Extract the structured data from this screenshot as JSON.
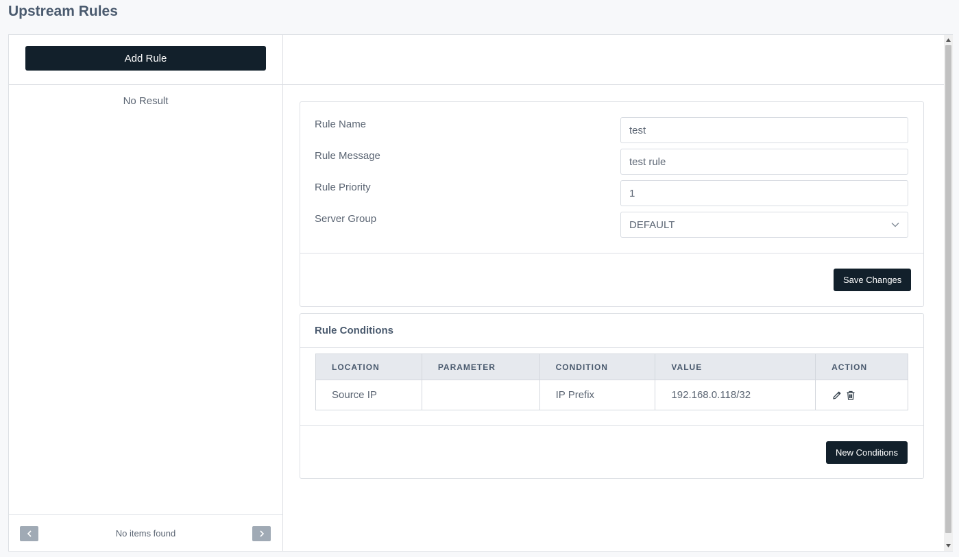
{
  "page": {
    "title": "Upstream Rules"
  },
  "sidebar": {
    "add_rule_label": "Add Rule",
    "empty_text": "No Result",
    "pager": {
      "status": "No items found"
    }
  },
  "form": {
    "rule_name": {
      "label": "Rule Name",
      "value": "test"
    },
    "rule_message": {
      "label": "Rule Message",
      "value": "test rule"
    },
    "rule_priority": {
      "label": "Rule Priority",
      "value": "1"
    },
    "server_group": {
      "label": "Server Group",
      "value": "DEFAULT"
    },
    "save_label": "Save Changes"
  },
  "conditions": {
    "title": "Rule Conditions",
    "columns": [
      "LOCATION",
      "PARAMETER",
      "CONDITION",
      "VALUE",
      "ACTION"
    ],
    "rows": [
      {
        "location": "Source IP",
        "parameter": "",
        "condition": "IP Prefix",
        "value": "192.168.0.118/32"
      }
    ],
    "new_label": "New Conditions"
  },
  "icons": {
    "pager_prev": "chevron-left-icon",
    "pager_next": "chevron-right-icon",
    "select": "chevron-down-icon",
    "edit": "pencil-icon",
    "delete": "trash-icon"
  },
  "colors": {
    "primary_button": "#12202b",
    "pager_button": "#a0aab5",
    "table_header": "#e6e9ee"
  }
}
